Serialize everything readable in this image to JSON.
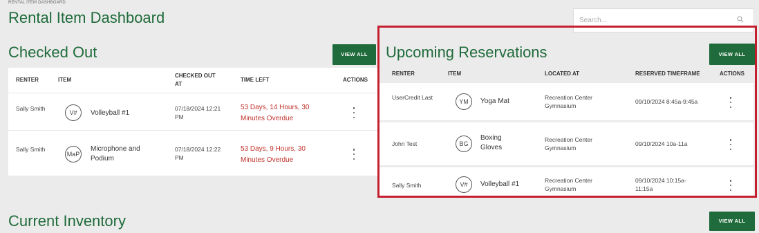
{
  "breadcrumb": "RENTAL ITEM DASHBOARD",
  "page_title": "Rental Item Dashboard",
  "search": {
    "placeholder": "Search..."
  },
  "checked_out": {
    "title": "Checked Out",
    "view_all": "VIEW ALL",
    "columns": {
      "renter": "RENTER",
      "item": "ITEM",
      "checked_out_at": "CHECKED OUT AT",
      "time_left": "TIME LEFT",
      "actions": "ACTIONS"
    },
    "rows": [
      {
        "renter": "Sally Smith",
        "badge": "V#",
        "item": "Volleyball #1",
        "checked_out_at": "07/18/2024 12:21 PM",
        "time_left": "53 Days, 14 Hours, 30 Minutes Overdue"
      },
      {
        "renter": "Sally Smith",
        "badge": "MaP",
        "item": "Microphone and Podium",
        "checked_out_at": "07/18/2024 12:22 PM",
        "time_left": "53 Days, 9 Hours, 30 Minutes Overdue"
      }
    ]
  },
  "reservations": {
    "title": "Upcoming Reservations",
    "view_all": "VIEW ALL",
    "columns": {
      "renter": "RENTER",
      "item": "ITEM",
      "located_at": "LOCATED AT",
      "reserved_timeframe": "RESERVED TIMEFRAME",
      "actions": "ACTIONS"
    },
    "rows": [
      {
        "renter": "UserCredit Last",
        "badge": "YM",
        "item": "Yoga Mat",
        "located_at": "Recreation Center Gymnasium",
        "timeframe": "09/10/2024 8:45a-9:45a"
      },
      {
        "renter": "John Test",
        "badge": "BG",
        "item": "Boxing Gloves",
        "located_at": "Recreation Center Gymnasium",
        "timeframe": "09/10/2024 10a-11a"
      },
      {
        "renter": "Sally Smith",
        "badge": "V#",
        "item": "Volleyball #1",
        "located_at": "Recreation Center Gymnasium",
        "timeframe": "09/10/2024 10:15a-11:15a"
      }
    ]
  },
  "inventory": {
    "title": "Current Inventory",
    "view_all": "VIEW ALL"
  },
  "colors": {
    "brand_green": "#1f6b3b",
    "overdue_red": "#c0322b",
    "highlight_red": "#c41e2f"
  }
}
